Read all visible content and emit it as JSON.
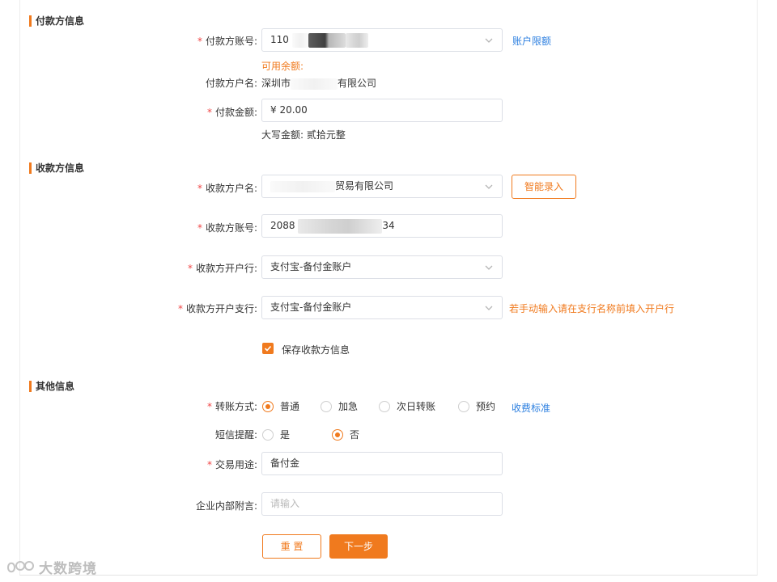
{
  "payer": {
    "section_title": "付款方信息",
    "account_label": "付款方账号:",
    "account_prefix": "110",
    "account_limit_link": "账户限额",
    "available_balance_label": "可用余额:",
    "name_label": "付款方户名:",
    "name_prefix": "深圳市",
    "name_suffix": "有限公司",
    "amount_label": "付款金额:",
    "amount_value": "¥  20.00",
    "amount_uppercase_label": "大写金额:",
    "amount_uppercase_value": "贰拾元整"
  },
  "payee": {
    "section_title": "收款方信息",
    "name_label": "收款方户名:",
    "name_suffix": "贸易有限公司",
    "smart_entry_button": "智能录入",
    "account_label": "收款方账号:",
    "account_prefix": "2088",
    "account_suffix": "34",
    "bank_label": "收款方开户行:",
    "bank_value": "支付宝-备付金账户",
    "branch_label": "收款方开户支行:",
    "branch_value": "支付宝-备付金账户",
    "branch_hint": "若手动输入请在支行名称前填入开户行",
    "save_checkbox_label": "保存收款方信息",
    "save_checked": true
  },
  "other": {
    "section_title": "其他信息",
    "transfer_method_label": "转账方式:",
    "transfer_methods": [
      "普通",
      "加急",
      "次日转账",
      "预约"
    ],
    "transfer_selected": "普通",
    "fee_link": "收费标准",
    "sms_label": "短信提醒:",
    "sms_options": [
      "是",
      "否"
    ],
    "sms_selected": "否",
    "purpose_label": "交易用途:",
    "purpose_value": "备付金",
    "internal_note_label": "企业内部附言:",
    "internal_note_placeholder": "请输入"
  },
  "actions": {
    "reset_button": "重 置",
    "next_button": "下一步"
  },
  "watermark": {
    "text": "大数跨境"
  },
  "colors": {
    "accent": "#f07a1e",
    "link": "#2e80e0",
    "required": "#f04646"
  }
}
